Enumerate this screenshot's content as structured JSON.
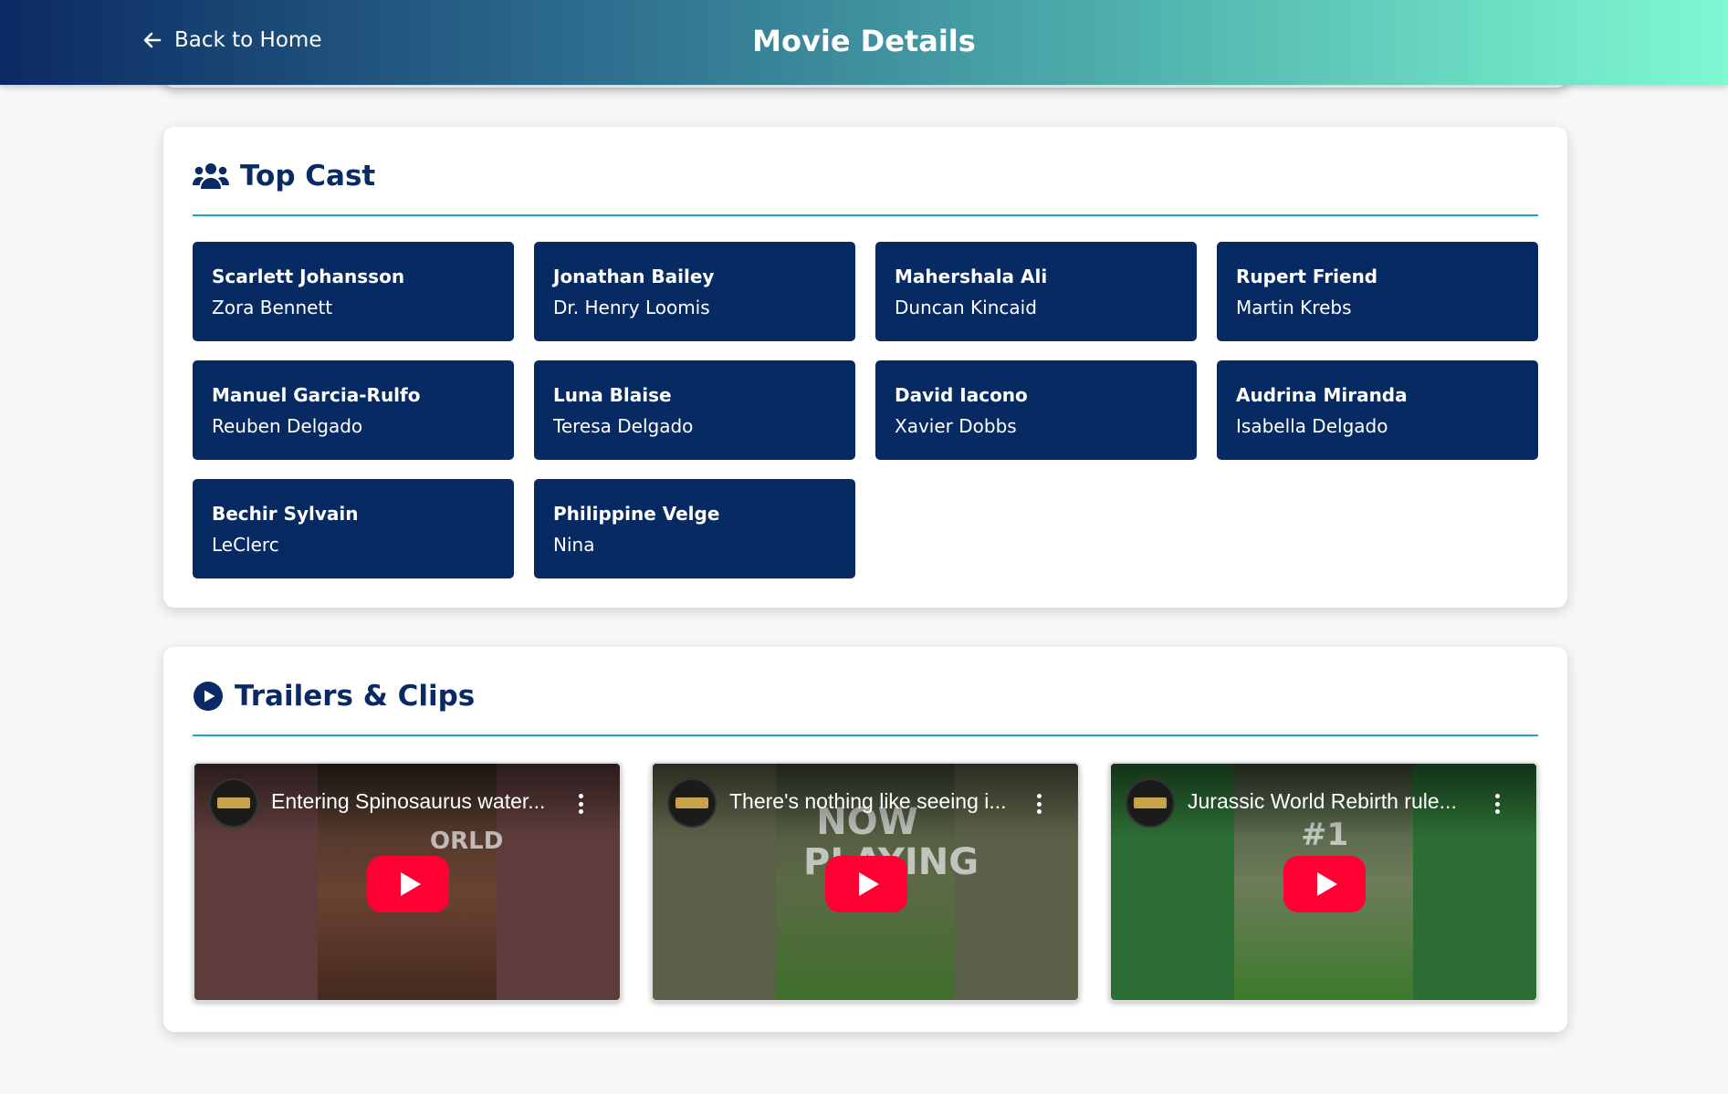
{
  "header": {
    "back_label": "Back to Home",
    "title": "Movie Details"
  },
  "cast": {
    "heading": "Top Cast",
    "members": [
      {
        "actor": "Scarlett Johansson",
        "role": "Zora Bennett"
      },
      {
        "actor": "Jonathan Bailey",
        "role": "Dr. Henry Loomis"
      },
      {
        "actor": "Mahershala Ali",
        "role": "Duncan Kincaid"
      },
      {
        "actor": "Rupert Friend",
        "role": "Martin Krebs"
      },
      {
        "actor": "Manuel Garcia-Rulfo",
        "role": "Reuben Delgado"
      },
      {
        "actor": "Luna Blaise",
        "role": "Teresa Delgado"
      },
      {
        "actor": "David Iacono",
        "role": "Xavier Dobbs"
      },
      {
        "actor": "Audrina Miranda",
        "role": "Isabella Delgado"
      },
      {
        "actor": "Bechir Sylvain",
        "role": "LeClerc"
      },
      {
        "actor": "Philippine Velge",
        "role": "Nina"
      }
    ]
  },
  "trailers": {
    "heading": "Trailers & Clips",
    "videos": [
      {
        "title": "Entering Spinosaurus water...",
        "overlay": "ORLD"
      },
      {
        "title": "There's nothing like seeing i...",
        "overlay": "NOW PLAYING"
      },
      {
        "title": "Jurassic World Rebirth rule...",
        "overlay": "#1"
      }
    ]
  },
  "colors": {
    "navy": "#082a63",
    "accent_line": "#17a6d0",
    "play_button": "#ff0033"
  },
  "icons": {
    "back": "arrow-left-icon",
    "cast": "users-icon",
    "trailers": "play-circle-icon",
    "video_menu": "kebab-icon"
  }
}
